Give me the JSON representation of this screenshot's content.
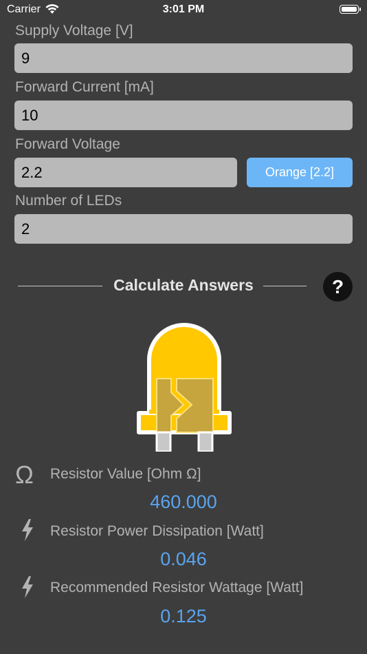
{
  "status_bar": {
    "carrier": "Carrier",
    "time": "3:01 PM"
  },
  "inputs": {
    "supply_voltage": {
      "label": "Supply Voltage [V]",
      "value": "9"
    },
    "forward_current": {
      "label": "Forward Current [mA]",
      "value": "10"
    },
    "forward_voltage": {
      "label": "Forward Voltage",
      "value": "2.2",
      "preset_button": "Orange [2.2]"
    },
    "number_of_leds": {
      "label": "Number of LEDs",
      "value": "2"
    }
  },
  "calculate": {
    "title": "Calculate Answers",
    "help": "?"
  },
  "led_colors": {
    "body": "#ffc800",
    "outline": "#ffffff",
    "chip": "#c6a53e",
    "legs": "#c8c8c8"
  },
  "results": [
    {
      "icon": "omega-icon",
      "symbol": "Ω",
      "label": "Resistor Value [Ohm Ω]",
      "value": "460.000"
    },
    {
      "icon": "lightning-icon",
      "label": "Resistor Power Dissipation [Watt]",
      "value": "0.046"
    },
    {
      "icon": "lightning-icon",
      "label": "Recommended Resistor Wattage [Watt]",
      "value": "0.125"
    }
  ],
  "colors": {
    "background": "#3d3d3d",
    "field": "#b9b9b9",
    "accent": "#6cb6f7",
    "result_value": "#5aa4ee"
  }
}
